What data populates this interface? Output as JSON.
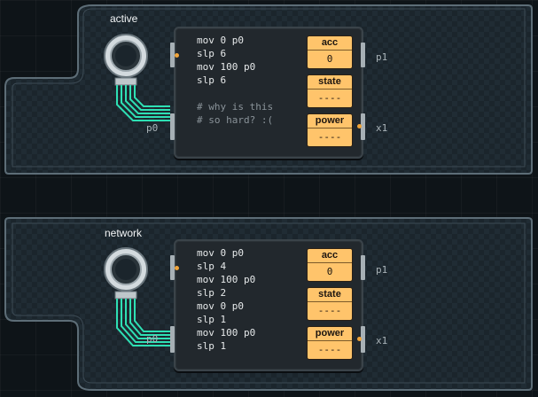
{
  "boards": [
    {
      "label": "active",
      "code": [
        "mov 0 p0",
        "slp 6",
        "mov 100 p0",
        "slp 6",
        "",
        "# why is this",
        "# so hard? :("
      ],
      "registers": [
        {
          "name": "acc",
          "value": "0"
        },
        {
          "name": "state",
          "value": "----"
        },
        {
          "name": "power",
          "value": "----"
        }
      ],
      "pins": {
        "left": "p0",
        "right_top": "p1",
        "right_bottom": "x1"
      }
    },
    {
      "label": "network",
      "code": [
        "mov 0 p0",
        "slp 4",
        "mov 100 p0",
        "slp 2",
        "mov 0 p0",
        "slp 1",
        "mov 100 p0",
        "slp 1"
      ],
      "registers": [
        {
          "name": "acc",
          "value": "0"
        },
        {
          "name": "state",
          "value": "----"
        },
        {
          "name": "power",
          "value": "----"
        }
      ],
      "pins": {
        "left": "p0",
        "right_top": "p1",
        "right_bottom": "x1"
      }
    }
  ],
  "colors": {
    "register": "#ffc46b",
    "wire": "#2ee0b4",
    "board": "#1d2a33"
  }
}
